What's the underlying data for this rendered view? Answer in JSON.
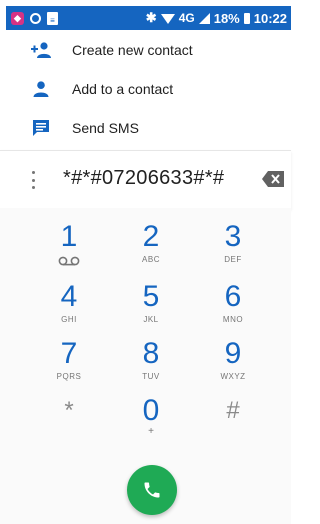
{
  "status_bar": {
    "network": "4G",
    "battery": "18%",
    "time": "10:22",
    "colors": {
      "background": "#1565c0"
    }
  },
  "suggestions": [
    {
      "label": "Create new contact",
      "icon": "person-add-icon"
    },
    {
      "label": "Add to a contact",
      "icon": "person-icon"
    },
    {
      "label": "Send SMS",
      "icon": "message-icon"
    }
  ],
  "dialer": {
    "digits": "*#*#07206633#*#",
    "keys": [
      {
        "digit": "1",
        "letters": ""
      },
      {
        "digit": "2",
        "letters": "ABC"
      },
      {
        "digit": "3",
        "letters": "DEF"
      },
      {
        "digit": "4",
        "letters": "GHI"
      },
      {
        "digit": "5",
        "letters": "JKL"
      },
      {
        "digit": "6",
        "letters": "MNO"
      },
      {
        "digit": "7",
        "letters": "PQRS"
      },
      {
        "digit": "8",
        "letters": "TUV"
      },
      {
        "digit": "9",
        "letters": "WXYZ"
      },
      {
        "digit": "*",
        "letters": ""
      },
      {
        "digit": "0",
        "letters": "+"
      },
      {
        "digit": "#",
        "letters": ""
      }
    ],
    "colors": {
      "digit": "#1565c0",
      "call": "#1faa55"
    }
  }
}
